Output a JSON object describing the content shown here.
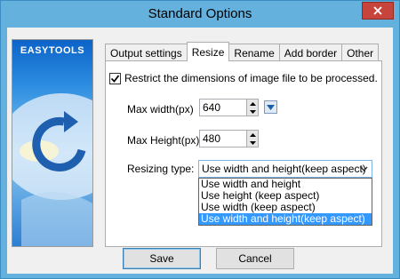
{
  "window": {
    "title": "Standard Options"
  },
  "banner": {
    "logo": "EASYTOOLS"
  },
  "tabs": [
    {
      "label": "Output settings",
      "active": false
    },
    {
      "label": "Resize",
      "active": true
    },
    {
      "label": "Rename",
      "active": false
    },
    {
      "label": "Add border",
      "active": false
    },
    {
      "label": "Other",
      "active": false
    }
  ],
  "resize": {
    "restrict_label": "Restrict the dimensions of image file to be processed.",
    "restrict_checked": true,
    "max_width_label": "Max width(px)",
    "max_width_value": "640",
    "max_height_label": "Max Height(px)",
    "max_height_value": "480",
    "resizing_type_label": "Resizing type:",
    "resizing_type_value": "Use width and height(keep aspect)",
    "resizing_options": [
      "Use width and height",
      "Use height (keep aspect)",
      "Use width (keep aspect)",
      "Use width and height(keep aspect)"
    ]
  },
  "buttons": {
    "save": "Save",
    "cancel": "Cancel"
  },
  "colors": {
    "titlebar": "#64b1de",
    "close": "#c6443c",
    "selection": "#3399ff"
  }
}
